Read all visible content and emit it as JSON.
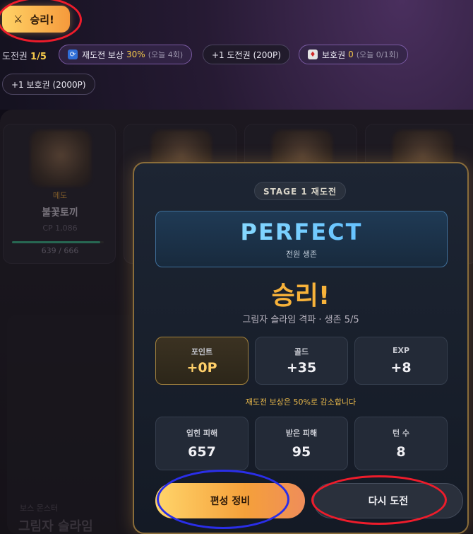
{
  "top": {
    "victory_label": "승리!",
    "victory_icon": "crossed-swords-icon"
  },
  "status": {
    "ticket_label": "도전권",
    "ticket_value": "1/5",
    "retry_reward_label": "재도전 보상",
    "retry_reward_value": "30%",
    "retry_reward_today": "(오늘 4회)",
    "buy_ticket": "+1 도전권 (200P)",
    "protect_label": "보호권",
    "protect_value": "0",
    "protect_today": "(오늘 0/1회)",
    "buy_protect": "+1 보호권 (2000P)"
  },
  "background": {
    "unit": {
      "role": "메도",
      "name": "불꽃토끼",
      "cp": "CP 1,086",
      "hp": "639 / 666",
      "hp_fraction": 0.959
    },
    "boss_label": "보스 몬스터",
    "boss_name": "그림자 슬라임"
  },
  "modal": {
    "stage": "STAGE 1 재도전",
    "perfect_title": "PERFECT",
    "perfect_sub": "전원 생존",
    "result_title": "승리!",
    "result_sub": "그림자 슬라임 격파 · 생존 5/5",
    "rewards": [
      {
        "label": "포인트",
        "value": "+0P"
      },
      {
        "label": "골드",
        "value": "+35"
      },
      {
        "label": "EXP",
        "value": "+8"
      }
    ],
    "notice": "재도전 보상은 50%로 감소합니다",
    "stats": [
      {
        "label": "입힌 피해",
        "value": "657"
      },
      {
        "label": "받은 피해",
        "value": "95"
      },
      {
        "label": "턴 수",
        "value": "8"
      }
    ],
    "formation_button": "편성 정비",
    "retry_button": "다시 도전"
  },
  "colors": {
    "accent_gold": "#f7b23a",
    "perfect_blue": "#7fd4ff",
    "annotation_red": "#ee1c2b",
    "annotation_blue": "#2a2ee8"
  }
}
